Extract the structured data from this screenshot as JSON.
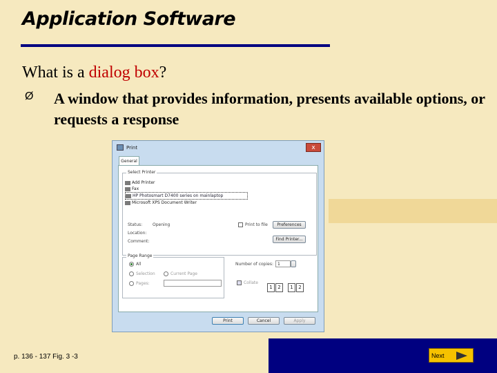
{
  "slide": {
    "title": "Application Software",
    "question_prefix": "What is a ",
    "question_highlight": "dialog box",
    "question_suffix": "?",
    "bullet_arrow": "Ø",
    "bullet_text": "A window that provides information, presents available options, or requests a response",
    "reference": "p. 136 - 137 Fig. 3 -3",
    "next_label": "Next",
    "colors": {
      "title_rule": "#000080",
      "highlight": "#c00000",
      "background": "#f6e9bf",
      "bottom_bar": "#000080",
      "next_button": "#f6c200"
    }
  },
  "dialog": {
    "title": "Print",
    "close_label": "x",
    "tab": "General",
    "select_printer_label": "Select Printer",
    "printers": [
      "Add Printer",
      "Fax",
      "HP Photosmart D7400 series on mainlaptop",
      "Microsoft XPS Document Writer"
    ],
    "status_label": "Status:",
    "status_value": "Opening",
    "location_label": "Location:",
    "comment_label": "Comment:",
    "print_to_file_label": "Print to file",
    "preferences_button": "Preferences",
    "find_printer_button": "Find Printer...",
    "page_range_label": "Page Range",
    "range_all": "All",
    "range_selection": "Selection",
    "range_current": "Current Page",
    "range_pages": "Pages:",
    "copies_label": "Number of copies:",
    "copies_value": "1",
    "collate_label": "Collate",
    "print_button": "Print",
    "cancel_button": "Cancel",
    "apply_button": "Apply"
  }
}
